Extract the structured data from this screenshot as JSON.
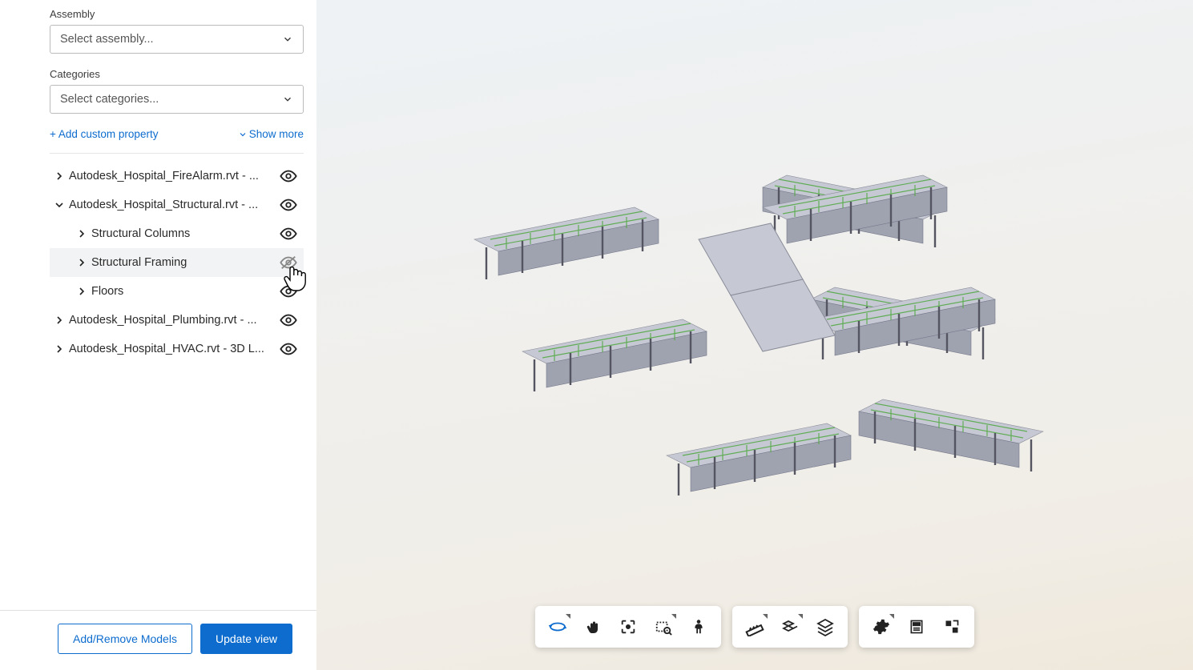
{
  "sidebar": {
    "assembly": {
      "label": "Assembly",
      "placeholder": "Select assembly..."
    },
    "categories": {
      "label": "Categories",
      "placeholder": "Select categories..."
    },
    "links": {
      "add_custom": "+ Add custom property",
      "show_more": "Show more"
    },
    "tree": [
      {
        "label": "Autodesk_Hospital_FireAlarm.rvt - ...",
        "expanded": false,
        "visible": true,
        "children": []
      },
      {
        "label": "Autodesk_Hospital_Structural.rvt - ...",
        "expanded": true,
        "visible": true,
        "children": [
          {
            "label": "Structural Columns",
            "visible": true
          },
          {
            "label": "Structural Framing",
            "visible": false,
            "hovered": true
          },
          {
            "label": "Floors",
            "visible": true
          }
        ]
      },
      {
        "label": "Autodesk_Hospital_Plumbing.rvt - ...",
        "expanded": false,
        "visible": true,
        "children": []
      },
      {
        "label": "Autodesk_Hospital_HVAC.rvt - 3D L...",
        "expanded": false,
        "visible": true,
        "children": []
      }
    ],
    "buttons": {
      "add_remove": "Add/Remove Models",
      "update": "Update view"
    }
  },
  "viewer": {
    "tools": {
      "nav": [
        "orbit",
        "pan",
        "zoom-fit",
        "zoom-window",
        "walk"
      ],
      "mid": [
        "measure",
        "explode",
        "layers"
      ],
      "right": [
        "settings",
        "properties",
        "fullscreen"
      ]
    }
  }
}
